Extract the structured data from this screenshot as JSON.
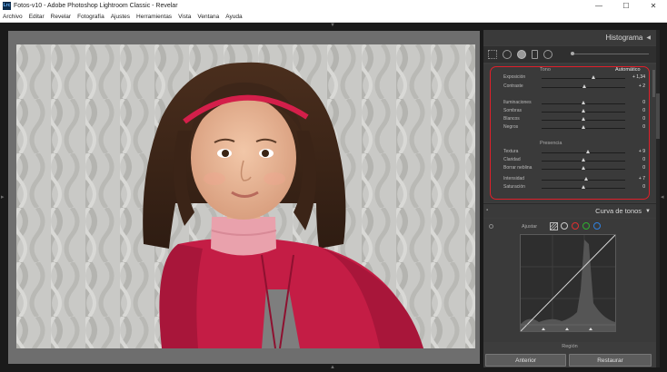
{
  "window": {
    "app_icon": "Lrc",
    "title": "Fotos-v10 - Adobe Photoshop Lightroom Classic - Revelar",
    "controls": [
      "—",
      "☐",
      "✕"
    ]
  },
  "menu": [
    "Archivo",
    "Editar",
    "Revelar",
    "Fotografía",
    "Ajustes",
    "Herramientas",
    "Vista",
    "Ventana",
    "Ayuda"
  ],
  "panel": {
    "histogram_title": "Histograma",
    "tone": {
      "section_label": "Tono",
      "auto_label": "Automático",
      "sliders": [
        {
          "label": "Exposición",
          "value": "+ 1,34",
          "level": 0.62
        },
        {
          "label": "Contraste",
          "value": "+ 2",
          "level": 0.51
        },
        {
          "label": "Iluminaciones",
          "value": "0",
          "level": 0.5
        },
        {
          "label": "Sombras",
          "value": "0",
          "level": 0.5
        },
        {
          "label": "Blancos",
          "value": "0",
          "level": 0.5
        },
        {
          "label": "Negros",
          "value": "0",
          "level": 0.5
        }
      ]
    },
    "presence": {
      "section_label": "Presencia",
      "sliders": [
        {
          "label": "Textura",
          "value": "+ 9",
          "level": 0.55
        },
        {
          "label": "Claridad",
          "value": "0",
          "level": 0.5
        },
        {
          "label": "Borrar neblina",
          "value": "0",
          "level": 0.5
        },
        {
          "label": "Intensidad",
          "value": "+ 7",
          "level": 0.53
        },
        {
          "label": "Saturación",
          "value": "0",
          "level": 0.5
        }
      ]
    },
    "curve_title": "Curva de tonos",
    "curve_adjust_label": "Ajustar",
    "curve_channels": [
      "#cccccc",
      "#e03030",
      "#30b030",
      "#3080e0"
    ],
    "region_label": "Región",
    "prev_button": "Anterior",
    "reset_button": "Restaurar"
  }
}
